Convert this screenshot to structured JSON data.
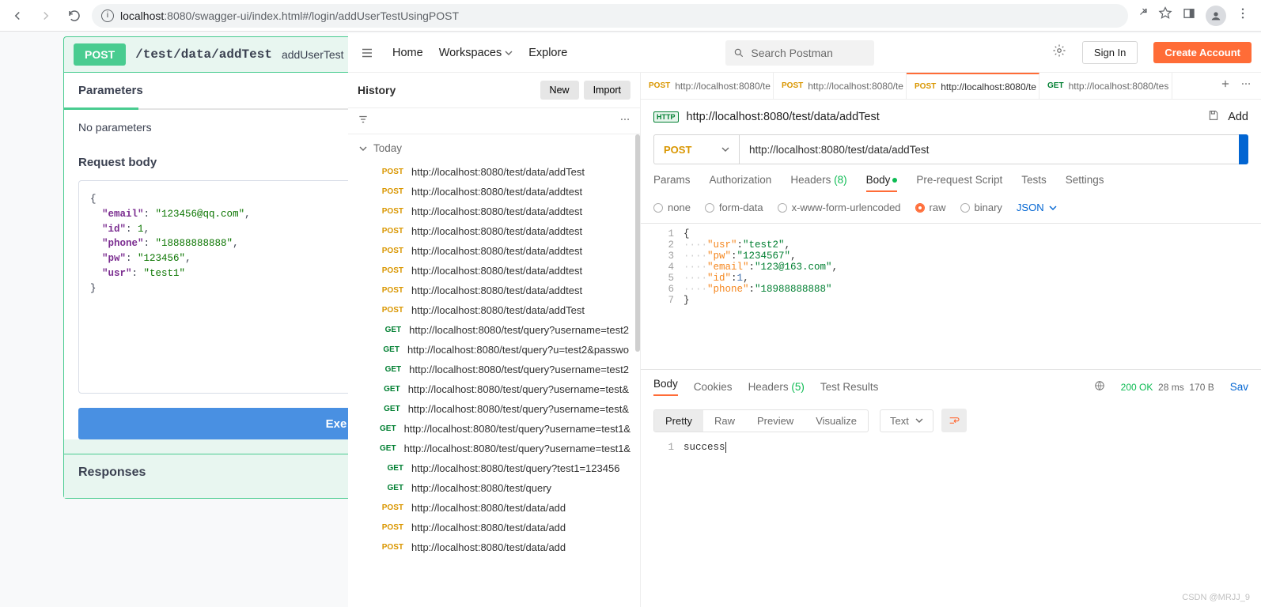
{
  "browser": {
    "url_host": "localhost",
    "url_port": ":8080",
    "url_path": "/swagger-ui/index.html#/login/addUserTestUsingPOST",
    "info_glyph": "i"
  },
  "swagger": {
    "method": "POST",
    "path": "/test/data/addTest",
    "op": "addUserTest",
    "params_title": "Parameters",
    "no_params": "No parameters",
    "req_body_title": "Request body",
    "exec_label": "Exe",
    "responses_title": "Responses",
    "body": {
      "l1": "{",
      "l2_k": "\"email\"",
      "l2_v": "\"123456@qq.com\"",
      "l2_tail": ",",
      "l3_k": "\"id\"",
      "l3_v": "1",
      "l3_tail": ",",
      "l4_k": "\"phone\"",
      "l4_v": "\"18888888888\"",
      "l4_tail": ",",
      "l5_k": "\"pw\"",
      "l5_v": "\"123456\"",
      "l5_tail": ",",
      "l6_k": "\"usr\"",
      "l6_v": "\"test1\"",
      "l7": "}"
    }
  },
  "postman": {
    "top": {
      "home": "Home",
      "workspaces": "Workspaces",
      "explore": "Explore",
      "search_placeholder": "Search Postman",
      "signin": "Sign In",
      "create": "Create Account"
    },
    "left": {
      "title": "History",
      "new": "New",
      "import": "Import",
      "today": "Today",
      "items": [
        {
          "method": "POST",
          "url": "http://localhost:8080/test/data/addTest"
        },
        {
          "method": "POST",
          "url": "http://localhost:8080/test/data/addtest"
        },
        {
          "method": "POST",
          "url": "http://localhost:8080/test/data/addtest"
        },
        {
          "method": "POST",
          "url": "http://localhost:8080/test/data/addtest"
        },
        {
          "method": "POST",
          "url": "http://localhost:8080/test/data/addtest"
        },
        {
          "method": "POST",
          "url": "http://localhost:8080/test/data/addtest"
        },
        {
          "method": "POST",
          "url": "http://localhost:8080/test/data/addtest"
        },
        {
          "method": "POST",
          "url": "http://localhost:8080/test/data/addTest"
        },
        {
          "method": "GET",
          "url": "http://localhost:8080/test/query?username=test2"
        },
        {
          "method": "GET",
          "url": "http://localhost:8080/test/query?u=test2&passwo"
        },
        {
          "method": "GET",
          "url": "http://localhost:8080/test/query?username=test2"
        },
        {
          "method": "GET",
          "url": "http://localhost:8080/test/query?username=test&"
        },
        {
          "method": "GET",
          "url": "http://localhost:8080/test/query?username=test&"
        },
        {
          "method": "GET",
          "url": "http://localhost:8080/test/query?username=test1&"
        },
        {
          "method": "GET",
          "url": "http://localhost:8080/test/query?username=test1&"
        },
        {
          "method": "GET",
          "url": "http://localhost:8080/test/query?test1=123456"
        },
        {
          "method": "GET",
          "url": "http://localhost:8080/test/query"
        },
        {
          "method": "POST",
          "url": "http://localhost:8080/test/data/add"
        },
        {
          "method": "POST",
          "url": "http://localhost:8080/test/data/add"
        },
        {
          "method": "POST",
          "url": "http://localhost:8080/test/data/add"
        }
      ]
    },
    "tabs": [
      {
        "method": "POST",
        "label": "http://localhost:8080/te",
        "sel": false
      },
      {
        "method": "POST",
        "label": "http://localhost:8080/te",
        "sel": false
      },
      {
        "method": "POST",
        "label": "http://localhost:8080/te",
        "sel": true
      },
      {
        "method": "GET",
        "label": "http://localhost:8080/tes",
        "sel": false
      }
    ],
    "request": {
      "badge_text": "HTTP",
      "title": "http://localhost:8080/test/data/addTest",
      "add_label": "Add",
      "method": "POST",
      "url_value": "http://localhost:8080/test/data/addTest"
    },
    "req_tabs": {
      "params": "Params",
      "auth": "Authorization",
      "headers": "Headers",
      "headers_count": "(8)",
      "body": "Body",
      "pre": "Pre-request Script",
      "tests": "Tests",
      "settings": "Settings"
    },
    "body_types": {
      "none": "none",
      "form": "form-data",
      "xform": "x-www-form-urlencoded",
      "raw": "raw",
      "binary": "binary",
      "json": "JSON"
    },
    "editor": {
      "lines": [
        {
          "no": "1",
          "pre": "",
          "content": "{"
        },
        {
          "no": "2",
          "pre": "····",
          "k": "\"usr\"",
          "v": "\"test2\"",
          "tail": ","
        },
        {
          "no": "3",
          "pre": "····",
          "k": "\"pw\"",
          "v": "\"1234567\"",
          "tail": ","
        },
        {
          "no": "4",
          "pre": "····",
          "k": "\"email\"",
          "v": "\"123@163.com\"",
          "tail": ","
        },
        {
          "no": "5",
          "pre": "····",
          "k": "\"id\"",
          "nv": "1",
          "tail": ","
        },
        {
          "no": "6",
          "pre": "····",
          "k": "\"phone\"",
          "v": "\"18988888888\""
        },
        {
          "no": "7",
          "pre": "",
          "content": "}"
        }
      ]
    },
    "response": {
      "tabs": {
        "body": "Body",
        "cookies": "Cookies",
        "headers": "Headers",
        "headers_count": "(5)",
        "tests": "Test Results"
      },
      "status_code": "200 OK",
      "time": "28 ms",
      "size": "170 B",
      "save": "Sav",
      "view": {
        "pretty": "Pretty",
        "raw": "Raw",
        "preview": "Preview",
        "vis": "Visualize",
        "text": "Text"
      },
      "lines": [
        {
          "no": "1",
          "content": "success"
        }
      ]
    }
  },
  "watermark": "CSDN @MRJJ_9"
}
